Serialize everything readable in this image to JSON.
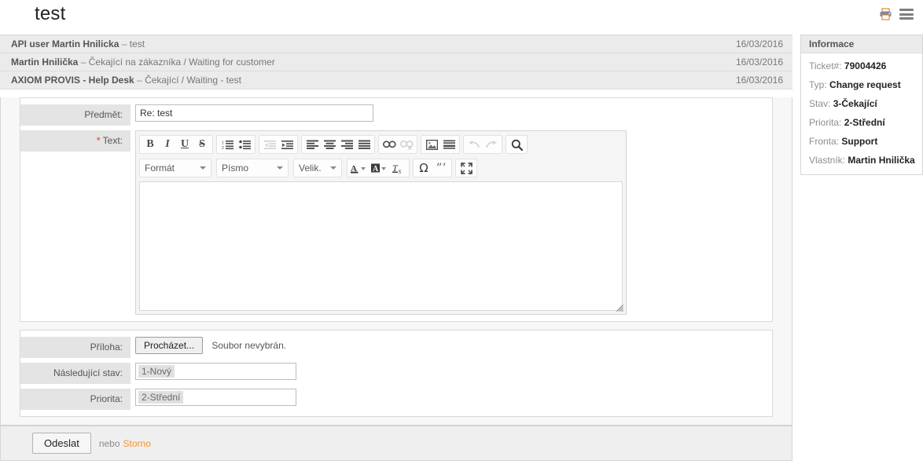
{
  "header": {
    "title": "test",
    "print_icon": "printer-icon",
    "menu_icon": "hamburger-menu-icon"
  },
  "history": [
    {
      "who": "API user Martin Hnilicka",
      "dash": "–",
      "what": "test",
      "date": "16/03/2016"
    },
    {
      "who": "Martin Hnilička",
      "dash": "–",
      "what": "Čekající na zákazníka / Waiting for customer",
      "date": "16/03/2016"
    },
    {
      "who": "AXIOM PROVIS - Help Desk",
      "dash": "–",
      "what": "Čekající / Waiting - test",
      "date": "16/03/2016"
    }
  ],
  "form": {
    "subject_label": "Předmět:",
    "subject_value": "Re: test",
    "subject_placeholder": "",
    "text_label": "Text:",
    "text_required_star": "*",
    "text_value": "",
    "attachment_label": "Příloha:",
    "browse_button": "Procházet...",
    "no_file_text": "Soubor nevybrán.",
    "next_state_label": "Následující stav:",
    "next_state_value": "1-Nový",
    "priority_label": "Priorita:",
    "priority_value": "2-Střední"
  },
  "editor": {
    "toolbar_row1": [
      {
        "name": "bold-icon",
        "glyph": "B",
        "disabled": false
      },
      {
        "name": "italic-icon",
        "glyph": "I",
        "disabled": false
      },
      {
        "name": "underline-icon",
        "glyph": "U",
        "disabled": false
      },
      {
        "name": "strikethrough-icon",
        "glyph": "S",
        "disabled": false
      },
      {
        "name": "numbered-list-icon",
        "glyph": "",
        "disabled": false
      },
      {
        "name": "bulleted-list-icon",
        "glyph": "",
        "disabled": false
      },
      {
        "name": "outdent-icon",
        "glyph": "",
        "disabled": true
      },
      {
        "name": "indent-icon",
        "glyph": "",
        "disabled": false
      },
      {
        "name": "align-left-icon",
        "glyph": "",
        "disabled": false
      },
      {
        "name": "align-center-icon",
        "glyph": "",
        "disabled": false
      },
      {
        "name": "align-right-icon",
        "glyph": "",
        "disabled": false
      },
      {
        "name": "align-justify-icon",
        "glyph": "",
        "disabled": false
      },
      {
        "name": "link-icon",
        "glyph": "",
        "disabled": false
      },
      {
        "name": "unlink-icon",
        "glyph": "",
        "disabled": true
      },
      {
        "name": "image-icon",
        "glyph": "",
        "disabled": false
      },
      {
        "name": "horizontal-rule-icon",
        "glyph": "",
        "disabled": false
      },
      {
        "name": "undo-icon",
        "glyph": "",
        "disabled": true
      },
      {
        "name": "redo-icon",
        "glyph": "",
        "disabled": true
      },
      {
        "name": "find-icon",
        "glyph": "",
        "disabled": false
      }
    ],
    "format_select": "Formát",
    "font_select": "Písmo",
    "size_select": "Velik...",
    "toolbar_row2": [
      {
        "name": "text-color-icon",
        "glyph": "A",
        "disabled": false
      },
      {
        "name": "background-color-icon",
        "glyph": "A",
        "disabled": false
      },
      {
        "name": "remove-format-icon",
        "glyph": "T",
        "disabled": false
      },
      {
        "name": "special-character-icon",
        "glyph": "Ω",
        "disabled": false
      },
      {
        "name": "blockquote-icon",
        "glyph": "❞",
        "disabled": false
      },
      {
        "name": "maximize-icon",
        "glyph": "",
        "disabled": false
      }
    ],
    "resize_grip": "resize-grip-icon"
  },
  "footer": {
    "submit_label": "Odeslat",
    "or_text": "nebo",
    "cancel_label": "Storno",
    "cancel_color": "#f0952f"
  },
  "sidebar": {
    "title": "Informace",
    "fields": [
      {
        "key": "Ticket#:",
        "value": "79004426"
      },
      {
        "key": "Typ:",
        "value": "Change request"
      },
      {
        "key": "Stav:",
        "value": "3-Čekající"
      },
      {
        "key": "Priorita:",
        "value": "2-Střední"
      },
      {
        "key": "Fronta:",
        "value": "Support"
      },
      {
        "key": "Vlastník:",
        "value": "Martin Hnilička"
      }
    ]
  }
}
